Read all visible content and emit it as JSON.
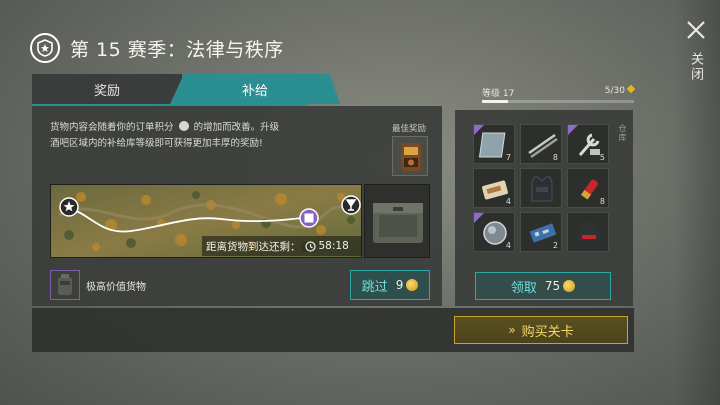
{
  "header": {
    "title": "第 15 赛季：法律与秩序",
    "close_label": "关闭"
  },
  "tabs": [
    {
      "label": "奖励",
      "active": false
    },
    {
      "label": "补给",
      "active": true
    }
  ],
  "supply": {
    "description_line1_before": "货物内容会随着你的订单积分",
    "description_line1_after": "的增加而改善。升级",
    "description_line2": "酒吧区域内的补给库等级即可获得更加丰厚的奖励!",
    "best_reward_label": "最佳奖励",
    "timer_label": "距离货物到达还剩：",
    "timer_value": "58:18",
    "cargo_label": "极高价值货物",
    "skip_label": "跳过",
    "skip_cost": "9"
  },
  "level": {
    "label": "等级 17",
    "count": "5/30",
    "progress": 0.17
  },
  "inventory": {
    "side_label": "仓库",
    "items": [
      {
        "icon": "glass-panel-icon",
        "qty": "7",
        "rare": true
      },
      {
        "icon": "rods-icon",
        "qty": "8",
        "rare": false
      },
      {
        "icon": "wrench-tools-icon",
        "qty": "5",
        "rare": true
      },
      {
        "icon": "ration-box-icon",
        "qty": "4",
        "rare": false
      },
      {
        "icon": "armor-vest-icon",
        "qty": "",
        "rare": false
      },
      {
        "icon": "shotgun-shell-icon",
        "qty": "8",
        "rare": false
      },
      {
        "icon": "lens-icon",
        "qty": "4",
        "rare": true
      },
      {
        "icon": "circuit-board-icon",
        "qty": "2",
        "rare": false
      },
      {
        "icon": "helmet-icon",
        "qty": "",
        "rare": false
      }
    ],
    "claim_label": "领取",
    "claim_cost": "75"
  },
  "footer": {
    "buy_label": "购买关卡"
  },
  "colors": {
    "accent_teal": "#2b8f92",
    "button_teal_text": "#6fe0dd",
    "gold": "#c7a52c",
    "rare_purple": "#8e6bc9"
  }
}
